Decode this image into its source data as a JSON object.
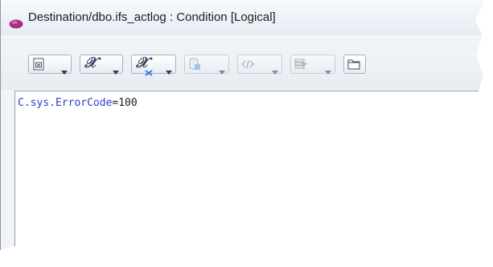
{
  "window": {
    "title": "Destination/dbo.ifs_actlog : Condition [Logical]"
  },
  "toolbar": {
    "buttons": [
      {
        "icon": "document-icon",
        "enabled": true
      },
      {
        "icon": "function-x-icon",
        "enabled": true
      },
      {
        "icon": "function-x-remove-icon",
        "enabled": true
      },
      {
        "icon": "database-icon",
        "enabled": false
      },
      {
        "icon": "code-tag-icon",
        "enabled": false
      },
      {
        "icon": "filter-icon",
        "enabled": false
      },
      {
        "icon": "folder-icon",
        "enabled": true
      }
    ]
  },
  "editor": {
    "expression": {
      "identifier": "C.sys.ErrorCode",
      "operator": "=",
      "value": "100"
    }
  },
  "colors": {
    "identifier": "#2a3fc8",
    "title_icon": "#a8327a"
  }
}
